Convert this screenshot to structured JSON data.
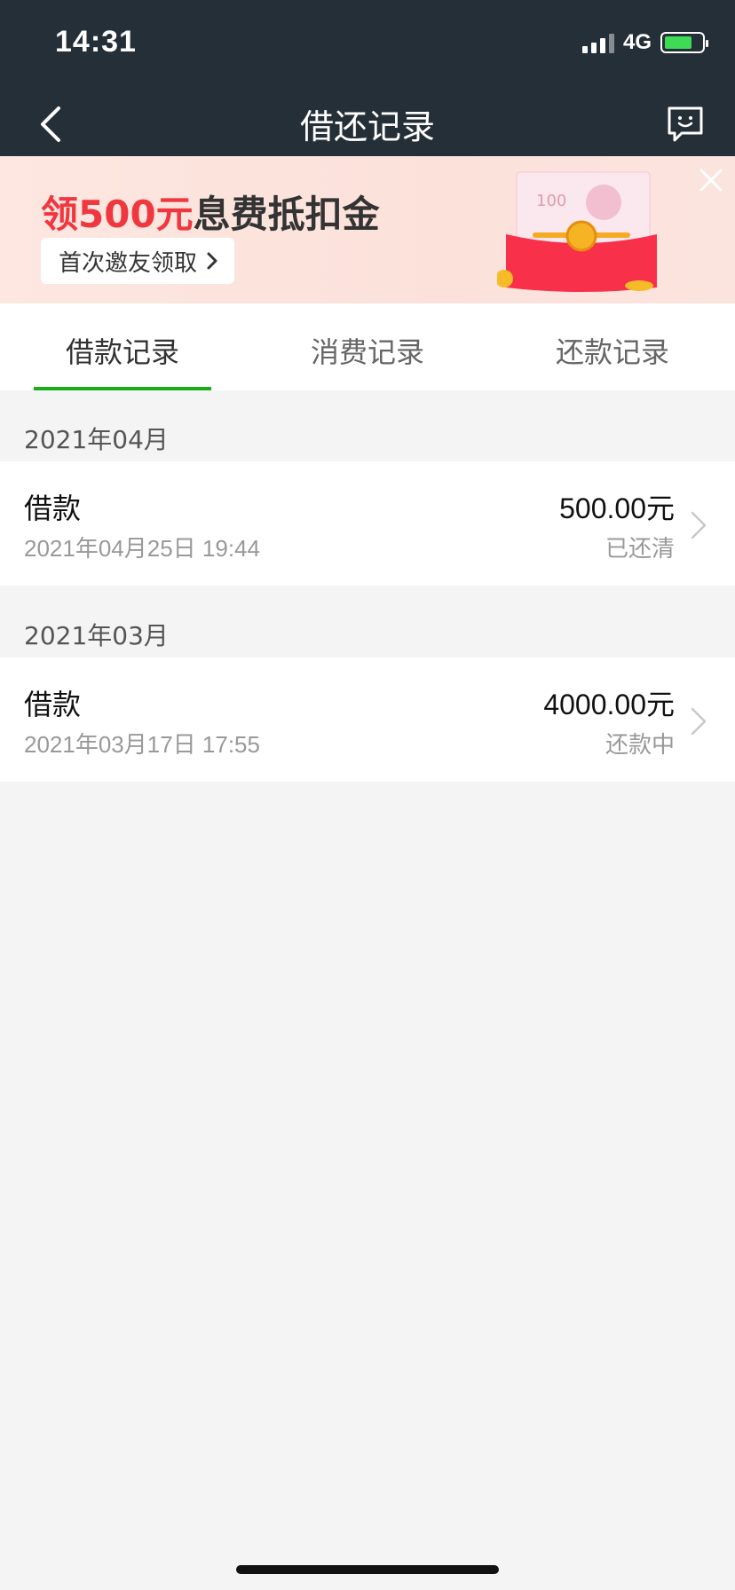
{
  "status_bar": {
    "time": "14:31",
    "network": "4G"
  },
  "nav": {
    "title": "借还记录"
  },
  "banner": {
    "title_highlight": "领500元",
    "title_rest": "息费抵扣金",
    "button_label": "首次邀友领取",
    "image_text": "100"
  },
  "tabs": [
    {
      "label": "借款记录",
      "active": true
    },
    {
      "label": "消费记录",
      "active": false
    },
    {
      "label": "还款记录",
      "active": false
    }
  ],
  "groups": [
    {
      "month": "2021年04月",
      "records": [
        {
          "type": "借款",
          "datetime": "2021年04月25日 19:44",
          "amount": "500.00元",
          "status": "已还清"
        }
      ]
    },
    {
      "month": "2021年03月",
      "records": [
        {
          "type": "借款",
          "datetime": "2021年03月17日 17:55",
          "amount": "4000.00元",
          "status": "还款中"
        }
      ]
    }
  ],
  "colors": {
    "header": "#252f38",
    "accent": "#1aad19",
    "promo_red": "#f0373f"
  }
}
